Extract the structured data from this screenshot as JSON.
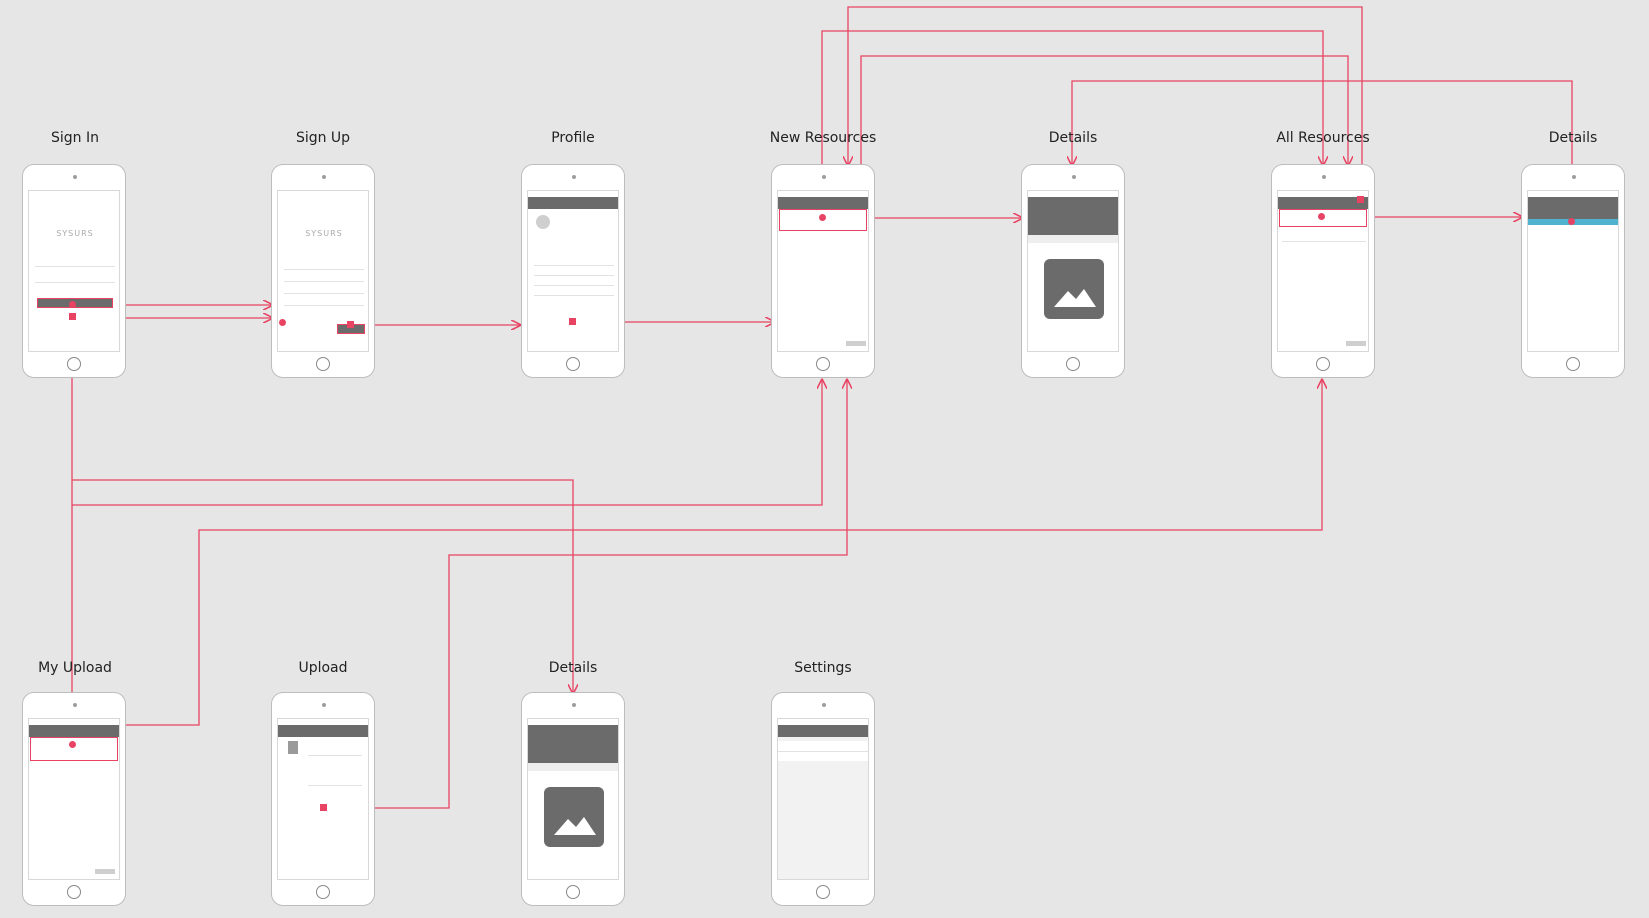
{
  "diagram": {
    "titles": {
      "sign_in": "Sign In",
      "sign_up": "Sign Up",
      "profile": "Profile",
      "new_resources": "New Resources",
      "details_1": "Details",
      "all_resources": "All Resources",
      "details_2": "Details",
      "my_upload": "My Upload",
      "upload": "Upload",
      "details_3": "Details",
      "settings": "Settings"
    },
    "logo": "SYSURS",
    "link_color": "#e94363",
    "highlight_color": "#4fb3d0"
  }
}
